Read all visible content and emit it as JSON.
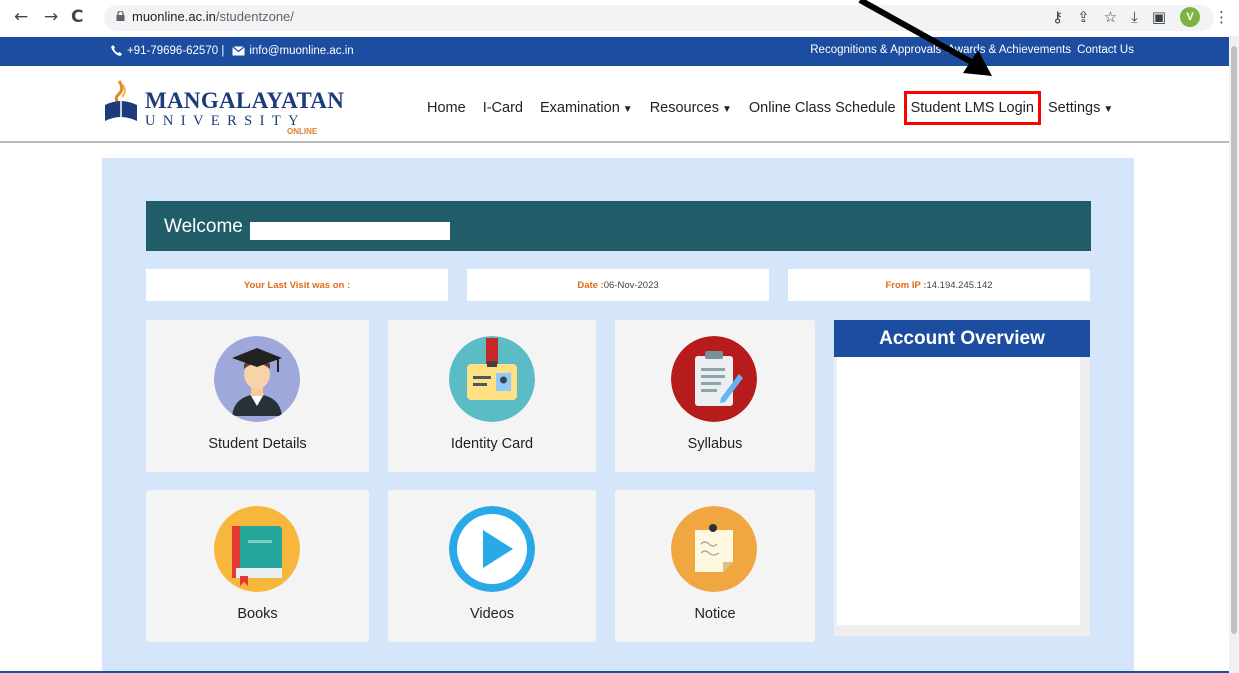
{
  "browser": {
    "back": "←",
    "forward": "→",
    "reload": "C",
    "url_host": "muonline.ac.in",
    "url_path": "/studentzone/",
    "avatar_letter": "V"
  },
  "topbar": {
    "phone": "+91-79696-62570 |",
    "email": "info@muonline.ac.in",
    "links": [
      "Recognitions & Approvals",
      "Awards & Achievements",
      "Contact Us"
    ]
  },
  "logo": {
    "main": "MANGALAYATAN",
    "sub": "UNIVERSITY",
    "online": "ONLINE"
  },
  "menu": {
    "items": [
      {
        "label": "Home",
        "dropdown": false
      },
      {
        "label": "I-Card",
        "dropdown": false
      },
      {
        "label": "Examination",
        "dropdown": true
      },
      {
        "label": "Resources",
        "dropdown": true
      },
      {
        "label": "Online Class Schedule",
        "dropdown": false
      },
      {
        "label": "Student LMS Login",
        "dropdown": false,
        "highlighted": true
      },
      {
        "label": "Settings",
        "dropdown": true
      }
    ],
    "caret": "▼"
  },
  "welcome": {
    "text": "Welcome"
  },
  "info": {
    "last_visit_label": "Your Last Visit was on :",
    "date_label": "Date :",
    "date_value": " 06-Nov-2023",
    "ip_label": "From IP :",
    "ip_value": " 14.194.245.142"
  },
  "tiles": [
    {
      "label": "Student Details",
      "icon": "graduate-icon",
      "color": "#9fa8da"
    },
    {
      "label": "Identity Card",
      "icon": "id-card-icon",
      "color": "#5bbcc6"
    },
    {
      "label": "Syllabus",
      "icon": "clipboard-icon",
      "color": "#b71c1c"
    },
    {
      "label": "Books",
      "icon": "book-icon",
      "color": "#f6b73c"
    },
    {
      "label": "Videos",
      "icon": "play-icon",
      "color": "#29a9e8"
    },
    {
      "label": "Notice",
      "icon": "notice-icon",
      "color": "#f0a742"
    }
  ],
  "account": {
    "title": "Account Overview"
  },
  "colors": {
    "brand_blue": "#1d4da0",
    "welcome_teal": "#215d68",
    "panel_bg": "#d5e6fb",
    "highlight_red": "#ff0000",
    "label_orange": "#e36b1a"
  }
}
